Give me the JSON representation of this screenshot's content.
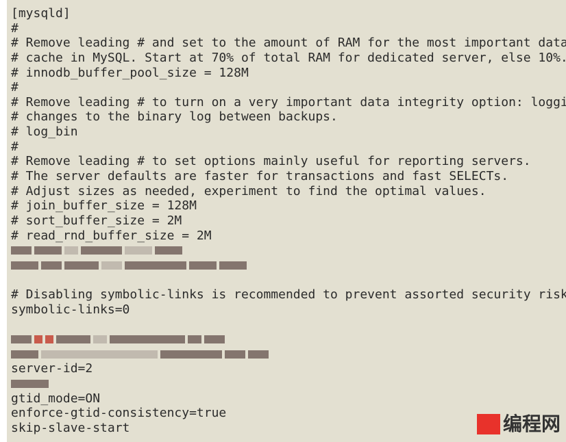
{
  "lines": [
    "[mysqld]",
    "#",
    "# Remove leading # and set to the amount of RAM for the most important data",
    "# cache in MySQL. Start at 70% of total RAM for dedicated server, else 10%.",
    "# innodb_buffer_pool_size = 128M",
    "#",
    "# Remove leading # to turn on a very important data integrity option: logging",
    "# changes to the binary log between backups.",
    "# log_bin",
    "#",
    "# Remove leading # to set options mainly useful for reporting servers.",
    "# The server defaults are faster for transactions and fast SELECTs.",
    "# Adjust sizes as needed, experiment to find the optimal values.",
    "# join_buffer_size = 128M",
    "# sort_buffer_size = 2M",
    "# read_rnd_buffer_size = 2M"
  ],
  "lines2": [
    "",
    "# Disabling symbolic-links is recommended to prevent assorted security risks",
    "symbolic-links=0",
    ""
  ],
  "lines3": [
    "server-id=2"
  ],
  "lines4": [
    "gtid_mode=ON",
    "enforce-gtid-consistency=true",
    "skip-slave-start"
  ],
  "watermark": {
    "logo": "hi",
    "text": "编程网",
    "color": "#e8322b"
  }
}
